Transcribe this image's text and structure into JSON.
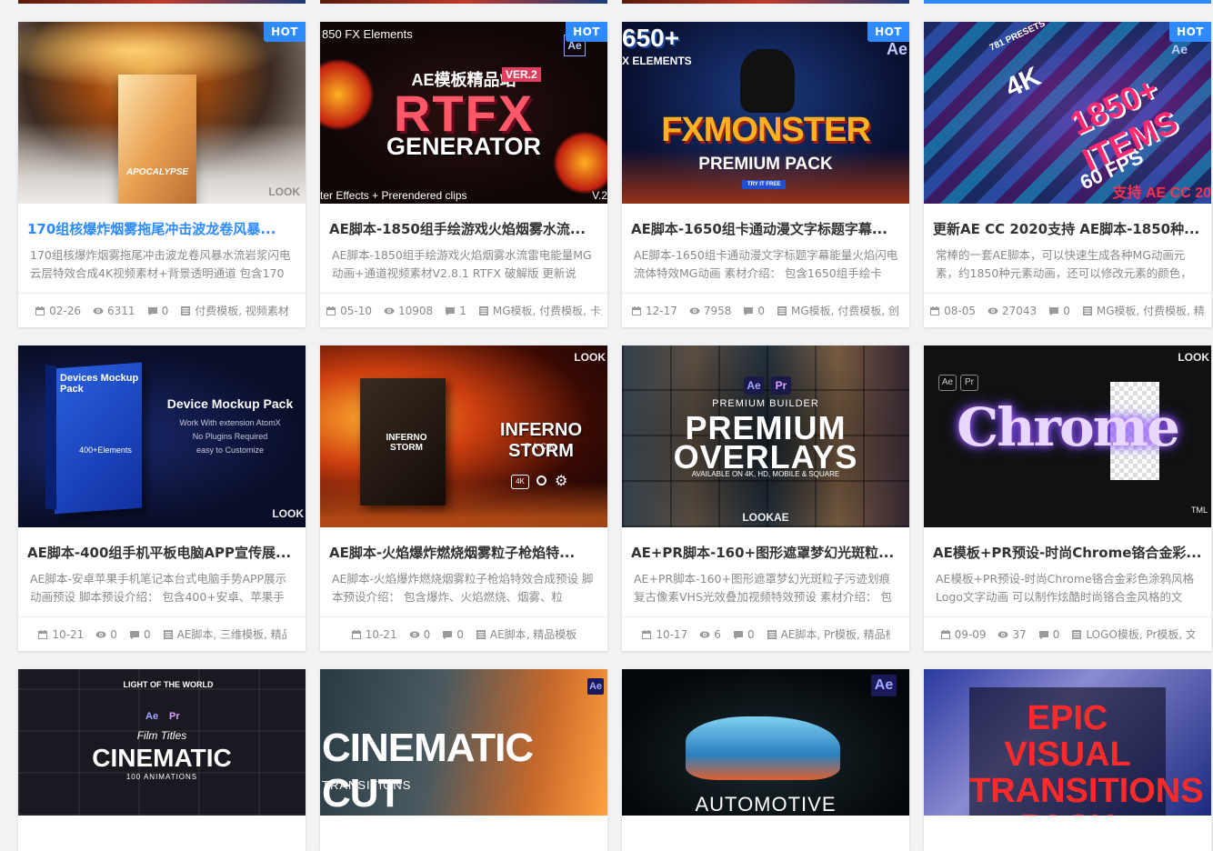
{
  "cards": [
    {
      "hot": "HOT",
      "thumb_text": "APOCALYPSE",
      "thumb_corner": "LOOK",
      "title": "170组核爆炸烟雾拖尾冲击波龙卷风暴...",
      "desc": "170组核爆炸烟雾拖尾冲击波龙卷风暴水流岩浆闪电云层特效合成4K视频素材+背景透明通道 包含170",
      "date": "02-26",
      "views": "6311",
      "comments": "0",
      "cats": "付费模板, 视频素材"
    },
    {
      "hot": "HOT",
      "thumb_text": "RTFX",
      "thumb_sub1": "AE模板精品站",
      "thumb_sub2": "GENERATOR",
      "thumb_corner": "850 FX Elements",
      "thumb_bottom": "ter Effects + Prerendered clips",
      "thumb_ver": "VER.2",
      "thumb_right": "V.2",
      "title": "AE脚本-1850组手绘游戏火焰烟雾水流...",
      "desc": "AE脚本-1850组手绘游戏火焰烟雾水流雷电能量MG动画+通道视频素材V2.8.1 RTFX 破解版 更新说明：",
      "date": "05-10",
      "views": "10908",
      "comments": "1",
      "cats": "MG模板, 付费模板, 卡通"
    },
    {
      "hot": "HOT",
      "thumb_text": "FXMONSTER",
      "thumb_sub1": "650+",
      "thumb_sub2": "PREMIUM PACK",
      "thumb_corner": "X ELEMENTS",
      "thumb_btn": "TRY IT FREE",
      "thumb_ae": "Ae",
      "title": "AE脚本-1650组卡通动漫文字标题字幕...",
      "desc": "AE脚本-1650组卡通动漫文字标题字幕能量火焰闪电流体特效MG动画 素材介绍： 包含1650组手绘卡",
      "date": "12-17",
      "views": "7958",
      "comments": "0",
      "cats": "MG模板, 付费模板, 创意"
    },
    {
      "hot": "HOT",
      "thumb_text": "1850+ ITEMS",
      "thumb_sub1": "4K",
      "thumb_sub2": "60 FPS",
      "thumb_corner": "781 PRESETS",
      "thumb_bottom": "支持 AE CC 20",
      "thumb_ae": "Ae",
      "title": "更新AE CC 2020支持 AE脚本-1850种...",
      "desc": "常棒的一套AE脚本，可以快速生成各种MG动画元素，约1850种元素动画，还可以修改元素的颜色，",
      "date": "08-05",
      "views": "27043",
      "comments": "0",
      "cats": "MG模板, 付费模板, 精品"
    },
    {
      "thumb_text": "Device Mockup Pack",
      "thumb_sub1": "Work With extension AtomX",
      "thumb_sub2": "No Plugins Required",
      "thumb_sub3": "easy to Customize",
      "thumb_box": "Devices Mockup Pack",
      "thumb_count": "400+Elements",
      "thumb_corner": "LOOK",
      "title": "AE脚本-400组手机平板电脑APP宣传展...",
      "desc": "AE脚本-安卓苹果手机笔记本台式电脑手势APP展示动画预设 脚本预设介绍： 包含400+安卓、苹果手",
      "date": "10-21",
      "views": "0",
      "comments": "0",
      "cats": "AE脚本, 三维模板, 精品模板"
    },
    {
      "thumb_text": "INFERNO STORM",
      "thumb_sub1": "PACK",
      "thumb_box": "INFERNO STORM",
      "thumb_corner": "LOOK",
      "thumb_badge": "4K",
      "title": "AE脚本-火焰爆炸燃烧烟雾粒子枪焰特...",
      "desc": "AE脚本-火焰爆炸燃烧烟雾粒子枪焰特效合成预设 脚本预设介绍： 包含爆炸、火焰燃烧、烟雾、粒",
      "date": "10-21",
      "views": "0",
      "comments": "0",
      "cats": "AE脚本, 精品模板"
    },
    {
      "thumb_text": "PREMIUM",
      "thumb_sub1": "PREMIUM BUILDER",
      "thumb_sub2": "OVERLAYS",
      "thumb_sub3": "AVAILABLE ON 4K, HD, MOBILE & SQUARE",
      "thumb_corner": "LOOKAE",
      "thumb_ae": "Ae",
      "thumb_pr": "Pr",
      "title": "AE+PR脚本-160+图形遮罩梦幻光斑粒...",
      "desc": "AE+PR脚本-160+图形遮罩梦幻光斑粒子污迹划痕复古像素VHS光效叠加视频特效预设 素材介绍： 包",
      "date": "10-17",
      "views": "6",
      "comments": "0",
      "cats": "AE脚本, Pr模板, 精品模板"
    },
    {
      "thumb_text": "Chrome",
      "thumb_corner": "LOOK",
      "thumb_ae": "Ae",
      "thumb_pr": "Pr",
      "thumb_bottom": "TML",
      "title": "AE模板+PR预设-时尚Chrome铬合金彩...",
      "desc": "AE模板+PR预设-时尚Chrome铬合金彩色涂鸦风格Logo文字动画 可以制作炫酷时尚铬合金风格的文",
      "date": "09-09",
      "views": "37",
      "comments": "0",
      "cats": "LOGO模板, Pr模板, 文字模"
    },
    {
      "thumb_text": "CINEMATIC",
      "thumb_sub1": "Film Titles",
      "thumb_sub2": "100 ANIMATIONS",
      "thumb_sub3": "LIGHT OF THE WORLD",
      "thumb_ae": "Ae",
      "thumb_pr": "Pr"
    },
    {
      "thumb_text": "CINEMATIC CUT",
      "thumb_sub1": "TRANSITIONS",
      "thumb_ae": "Ae"
    },
    {
      "thumb_text": "AUTOMOTIVE",
      "thumb_ae": "Ae"
    },
    {
      "thumb_text": "EPIC VISUAL TRANSITIONS PACK"
    }
  ]
}
